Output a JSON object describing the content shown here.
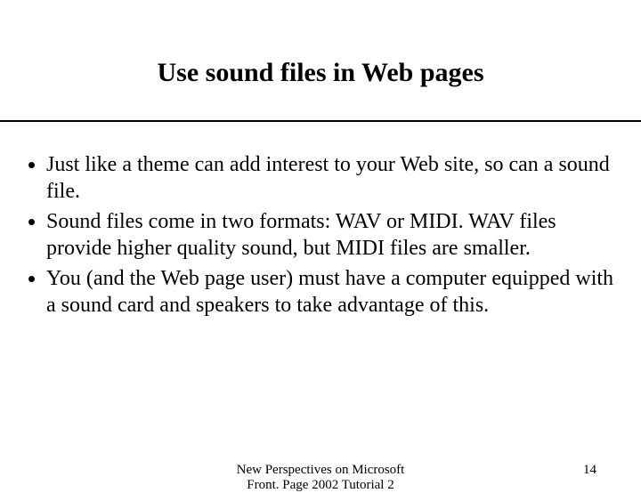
{
  "slide": {
    "title": "Use sound files in Web pages",
    "bullets": [
      "Just like a theme can add interest to your Web site, so can a sound file.",
      "Sound files come in two formats: WAV or MIDI. WAV files provide higher quality sound, but MIDI files are smaller.",
      "You (and the Web page user) must have a computer equipped with a sound card and speakers to take advantage of this."
    ],
    "footer": {
      "line1": "New Perspectives on Microsoft",
      "line2": "Front. Page 2002 Tutorial 2",
      "page_number": "14"
    }
  }
}
